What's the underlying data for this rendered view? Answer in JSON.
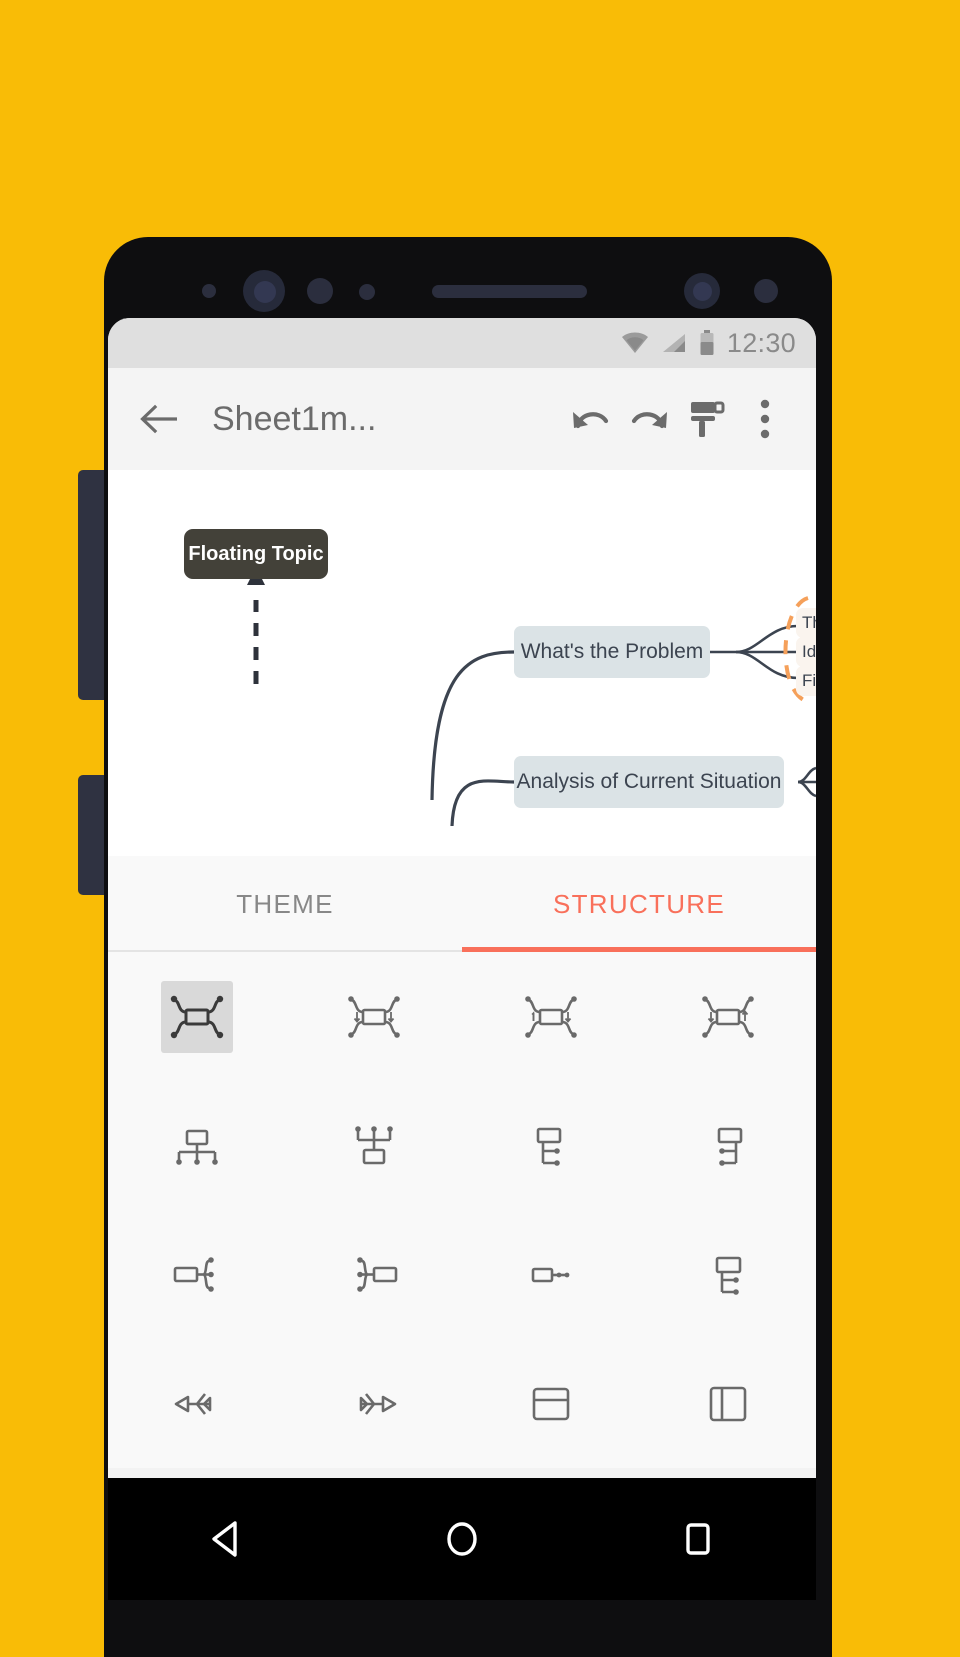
{
  "wallpaper_color": "#F9BC06",
  "device": {
    "frame_color": "#0E0E10",
    "button_color": "#2F3241",
    "sensor_color": "#2B2E3E"
  },
  "status_bar": {
    "time": "12:30",
    "icons": [
      "wifi-icon",
      "cell-signal-icon",
      "battery-icon"
    ],
    "background": "#DFDFDF",
    "foreground": "#8A8A8A"
  },
  "app_bar": {
    "back_label": "back-arrow",
    "title": "Sheet1m...",
    "actions": [
      {
        "name": "undo",
        "label": "undo-icon"
      },
      {
        "name": "redo",
        "label": "redo-icon"
      },
      {
        "name": "style",
        "label": "paint-roller-icon"
      },
      {
        "name": "more",
        "label": "overflow-menu-icon"
      }
    ]
  },
  "canvas": {
    "background": "#FFFFFF",
    "branch_color": "#3C4450",
    "selection_color": "#F5A05A",
    "floating_topic": {
      "text": "Floating Topic",
      "background": "#434139",
      "text_color": "#FFFFFF"
    },
    "nodes": [
      {
        "text": "What's the Problem",
        "background": "#DBE3E6"
      },
      {
        "text": "Analysis of Current Situation",
        "background": "#DBE3E6"
      }
    ],
    "clipped_subtopics": [
      "Th",
      "Ide",
      "Fir"
    ]
  },
  "tabs": {
    "items": [
      {
        "label": "THEME",
        "active": false
      },
      {
        "label": "STRUCTURE",
        "active": true
      }
    ],
    "active_color": "#F9705B",
    "inactive_color": "#888888"
  },
  "structure_grid": {
    "selected_index": 0,
    "items": [
      {
        "name": "map-balanced",
        "label": "Balanced Map"
      },
      {
        "name": "map-down-right",
        "label": "Map Down Right"
      },
      {
        "name": "map-numbered",
        "label": "Numbered Map"
      },
      {
        "name": "map-down-left",
        "label": "Map Down Left"
      },
      {
        "name": "org-chart-down",
        "label": "Org Chart Down"
      },
      {
        "name": "org-chart-up",
        "label": "Org Chart Up"
      },
      {
        "name": "tree-right",
        "label": "Tree Right"
      },
      {
        "name": "tree-left",
        "label": "Tree Left"
      },
      {
        "name": "logic-right",
        "label": "Logic Chart Right"
      },
      {
        "name": "logic-left",
        "label": "Logic Chart Left"
      },
      {
        "name": "timeline-arrow",
        "label": "Timeline"
      },
      {
        "name": "tree-table",
        "label": "Tree Table"
      },
      {
        "name": "fishbone-left",
        "label": "Fishbone Left"
      },
      {
        "name": "fishbone-right",
        "label": "Fishbone Right"
      },
      {
        "name": "horizontal-split",
        "label": "Horizontal Split"
      },
      {
        "name": "vertical-split",
        "label": "Vertical Split"
      }
    ]
  },
  "nav_bar": {
    "items": [
      {
        "name": "back",
        "label": "triangle-back-icon"
      },
      {
        "name": "home",
        "label": "circle-home-icon"
      },
      {
        "name": "recents",
        "label": "square-recents-icon"
      }
    ]
  }
}
